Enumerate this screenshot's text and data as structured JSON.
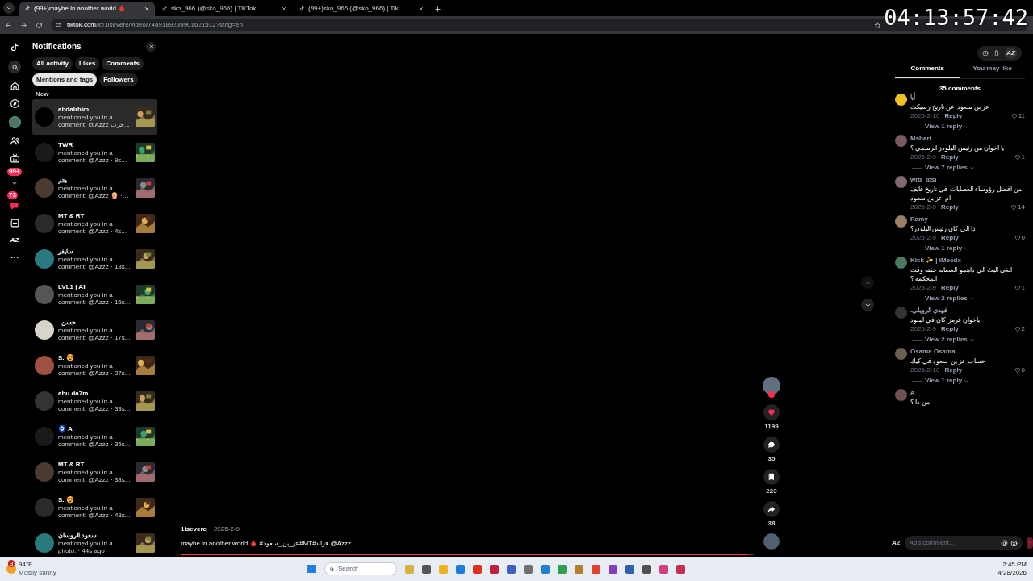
{
  "browser": {
    "tabs": [
      {
        "title": "(99+)maybe in another world 🩸",
        "selected": true
      },
      {
        "title": "sko_966 (@sko_966) | TikTok",
        "selected": false
      },
      {
        "title": "(99+)sko_966 (@sko_966) | Tik",
        "selected": false
      }
    ],
    "url_host": "tiktok.com",
    "url_path": "/@1isevere/video/7469189239901621512?lang=en"
  },
  "timer": "04:13:57:42",
  "nav": {
    "badges": [
      {
        "kind": "activity",
        "text": "99+"
      },
      {
        "kind": "inbox",
        "text": "73"
      }
    ],
    "profile_text": "AZ"
  },
  "notifications": {
    "title": "Notifications",
    "filters": [
      {
        "label": "All activity",
        "selected": false
      },
      {
        "label": "Likes",
        "selected": false
      },
      {
        "label": "Comments",
        "selected": false
      },
      {
        "label": "Mentions and tags",
        "selected": true
      },
      {
        "label": "Followers",
        "selected": false
      }
    ],
    "section": "New",
    "items": [
      {
        "name": "abdalrhim",
        "text": "mentioned you in a comment: @Azzz حرب...",
        "highlighted": true
      },
      {
        "name": "TWR",
        "text": "mentioned you in a comment: @Azzz · 9s...",
        "highlighted": false
      },
      {
        "name": "هتم",
        "text": "mentioned you in a comment: @Azzz 🍿 ·...",
        "highlighted": false
      },
      {
        "name": "MT & RT",
        "text": "mentioned you in a comment: @Azzz · 4s...",
        "highlighted": false
      },
      {
        "name": "سايفر",
        "text": "mentioned you in a comment: @Azzz · 13s...",
        "highlighted": false
      },
      {
        "name": "LVL1 | All",
        "text": "mentioned you in a comment: @Azzz · 15s...",
        "highlighted": false
      },
      {
        "name": ". حسن",
        "text": "mentioned you in a comment: @Azzz · 17s...",
        "highlighted": false
      },
      {
        "name": "S. 😍",
        "text": "mentioned you in a comment: @Azzz · 27s...",
        "highlighted": false
      },
      {
        "name": "abu da7m",
        "text": "mentioned you in a comment: @Azzz · 33s...",
        "highlighted": false
      },
      {
        "name": "🧿 A",
        "text": "mentioned you in a comment: @Azzz · 35s...",
        "highlighted": false
      },
      {
        "name": "MT & RT",
        "text": "mentioned you in a comment: @Azzz · 38s...",
        "highlighted": false
      },
      {
        "name": "S. 😍",
        "text": "mentioned you in a comment: @Azzz · 43s...",
        "highlighted": false
      },
      {
        "name": "سعود الروسان",
        "text": "mentioned you in a photo. · 44s ago",
        "highlighted": false
      }
    ]
  },
  "video": {
    "author": "1isevere",
    "date": "· 2025-2-9",
    "caption": "maybe in another world 🩸 #عز_بن_سعود#MT#قراند @Azzz",
    "progress": {
      "level": 0.99
    },
    "actions": [
      {
        "kind": "like",
        "count": "1199",
        "on": true
      },
      {
        "kind": "comment",
        "count": "35",
        "on": false
      },
      {
        "kind": "save",
        "count": "223",
        "on": false
      },
      {
        "kind": "share",
        "count": "38",
        "on": false
      }
    ]
  },
  "comments_panel": {
    "profile_text": "AZ",
    "tabs": [
      {
        "label": "Comments",
        "selected": true
      },
      {
        "label": "You may like",
        "selected": false
      }
    ],
    "count": "35 comments",
    "comments": [
      {
        "author": "أيا",
        "text": "عز بن سعود عن تاريخ رسيكت",
        "date": "2025-2-10",
        "reply": "Reply",
        "likes": "11",
        "replies": "View 1 reply"
      },
      {
        "author": "Mshari",
        "text": "يا اخوان من رئيس البلودز الرسمي ؟",
        "date": "2025-2-9",
        "reply": "Reply",
        "likes": "1",
        "replies": "View 7 replies"
      },
      {
        "author": "wrd_tcsl",
        "text": "من افضل رؤوساء العصابات في تاريخ فايف ام عز بن سعود",
        "date": "2025-2-9",
        "reply": "Reply",
        "likes": "14"
      },
      {
        "author": "Ramy",
        "text": "ذا الي كان رئيس البلودز؟",
        "date": "2025-2-9",
        "reply": "Reply",
        "likes": "0",
        "replies": "View 1 reply"
      },
      {
        "author": "Kick ✨ | iMeedx",
        "text": "ابغى البث الي داهمو العصابه حقته وقت المحكمه ؟",
        "date": "2025-2-9",
        "reply": "Reply",
        "likes": "1",
        "replies": "View 2 replies"
      },
      {
        "author": ".فهدي الرويلي",
        "text": "ياخوان فرمز كان في البلود",
        "date": "2025-2-9",
        "reply": "Reply",
        "likes": "2",
        "replies": "View 2 replies"
      },
      {
        "author": "Osama Osama",
        "text": "حساب عز بن سعود في كيك",
        "date": "2025-2-10",
        "reply": "Reply",
        "likes": "0",
        "replies": "View 1 reply"
      },
      {
        "author": "A",
        "text": "من ذا ؟"
      }
    ],
    "input": {
      "avatar_text": "AZ",
      "placeholder": "Add comment..."
    }
  },
  "taskbar": {
    "weather_badge": "3",
    "temp": "94°F",
    "weather": "Mostly sunny",
    "search_placeholder": "Search",
    "time": "2:45 PM",
    "date": "4/28/2026"
  }
}
